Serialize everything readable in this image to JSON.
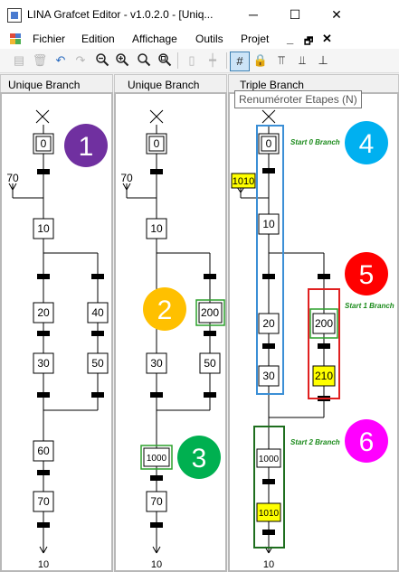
{
  "window": {
    "title": "LINA Grafcet Editor - v1.0.2.0 - [Uniq...",
    "buttons": [
      "─",
      "☐",
      "✕"
    ]
  },
  "menu": {
    "items": [
      "Fichier",
      "Edition",
      "Affichage",
      "Outils",
      "Projet"
    ],
    "mdi": [
      "_",
      "🗗",
      "✕"
    ]
  },
  "tooltip": "Renuméroter Etapes (N)",
  "panels": [
    {
      "title": "Unique Branch",
      "badges": [
        {
          "label": "1",
          "color": "#7030a0"
        }
      ],
      "steps": {
        "init": "0",
        "after_init": "10",
        "branch_a": [
          "20",
          "30"
        ],
        "branch_b": [
          "40",
          "50"
        ],
        "after_join": [
          "60",
          "70"
        ],
        "end": "10",
        "input": "70"
      }
    },
    {
      "title": "Unique Branch",
      "badges": [
        {
          "label": "2",
          "color": "#ffc000"
        },
        {
          "label": "3",
          "color": "#00b050"
        }
      ],
      "steps": {
        "init": "0",
        "after_init": "10",
        "branch_a": [
          "20",
          "30"
        ],
        "branch_b": [
          "200",
          "50"
        ],
        "after_join": [
          "1000",
          "70"
        ],
        "end": "10",
        "input": "70"
      }
    },
    {
      "title": "Triple Branch",
      "badges": [
        {
          "label": "4",
          "color": "#00b0f0"
        },
        {
          "label": "5",
          "color": "#ff0000"
        },
        {
          "label": "6",
          "color": "#ff00ff"
        }
      ],
      "steps": {
        "init": "0",
        "after_init": "10",
        "branch_a": [
          "20",
          "30"
        ],
        "branch_b": [
          "200",
          "210"
        ],
        "after_join": [
          "1000",
          "1010"
        ],
        "end": "10",
        "input": "1010"
      },
      "annotations": [
        "Start 0 Branch",
        "Start 1 Branch",
        "Start 2 Branch"
      ]
    }
  ],
  "colors": {
    "highlight_box_green": "#2ca02c",
    "highlight_fill_yellow": "#ffff00",
    "annotation_green": "#1a8a1a",
    "branch_blue": "#3b8fd6",
    "branch_red": "#e02020",
    "branch_darkgreen": "#1e6e1e"
  }
}
